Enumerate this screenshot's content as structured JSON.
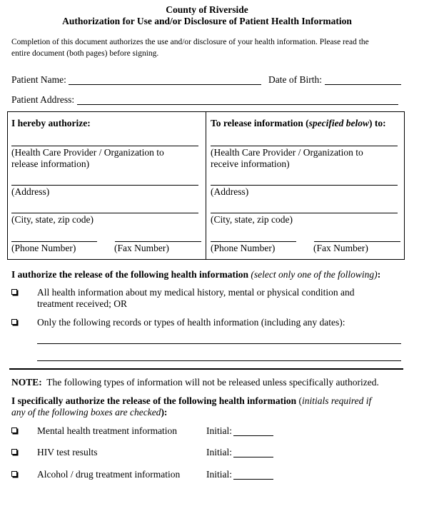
{
  "header": {
    "organization": "County of Riverside",
    "title": "Authorization for Use and/or Disclosure of Patient Health Information"
  },
  "intro": {
    "line1": "Completion of this document authorizes the use and/or disclosure of your health information.  Please read the",
    "line2": "entire document (both pages) before signing."
  },
  "patient": {
    "name_label": "Patient Name:",
    "name_value": "",
    "dob_label": "Date of Birth:",
    "dob_value": "",
    "address_label": "Patient Address:",
    "address_value": ""
  },
  "authorize_box": {
    "left": {
      "heading": "I hereby authorize:",
      "provider_label_1": "(Health Care Provider / Organization to",
      "provider_label_2": "release information)",
      "address_label": "(Address)",
      "city_label": "(City, state, zip code)",
      "phone_label": "(Phone Number)",
      "fax_label": "(Fax Number)"
    },
    "right": {
      "heading_pre": "To release information (",
      "heading_italic": "specified below",
      "heading_post": ") to:",
      "provider_label_1": "(Health Care Provider / Organization  to",
      "provider_label_2": "receive information)",
      "address_label": "(Address)",
      "city_label": "(City, state, zip code)",
      "phone_label": "(Phone Number)",
      "fax_label": "(Fax Number)"
    }
  },
  "release_section": {
    "heading": "I authorize the release of the following health information",
    "heading_italic": "(select only one of the following)",
    "heading_colon": ":",
    "options": [
      {
        "line1": "All health information about my medical history, mental or physical condition and",
        "line2": "treatment received; OR",
        "checked": false
      },
      {
        "line1": "Only the following records or types of health information (including any dates):",
        "line2": "",
        "checked": false
      }
    ]
  },
  "note": {
    "label": "NOTE:",
    "text": "  The following types of information will not be released unless specifically authorized."
  },
  "specific_section": {
    "heading": "I specifically authorize the release of the following health information",
    "heading_italic_pre": "(",
    "heading_italic_1": "initials required if",
    "heading_italic_2": "any of the following boxes are checked",
    "heading_italic_post": "):",
    "items": [
      {
        "label": "Mental health treatment information",
        "initial_label": "Initial:",
        "checked": false
      },
      {
        "label": "HIV test results",
        "initial_label": "Initial:",
        "checked": false
      },
      {
        "label": "Alcohol / drug treatment information",
        "initial_label": "Initial:",
        "checked": false
      }
    ]
  }
}
